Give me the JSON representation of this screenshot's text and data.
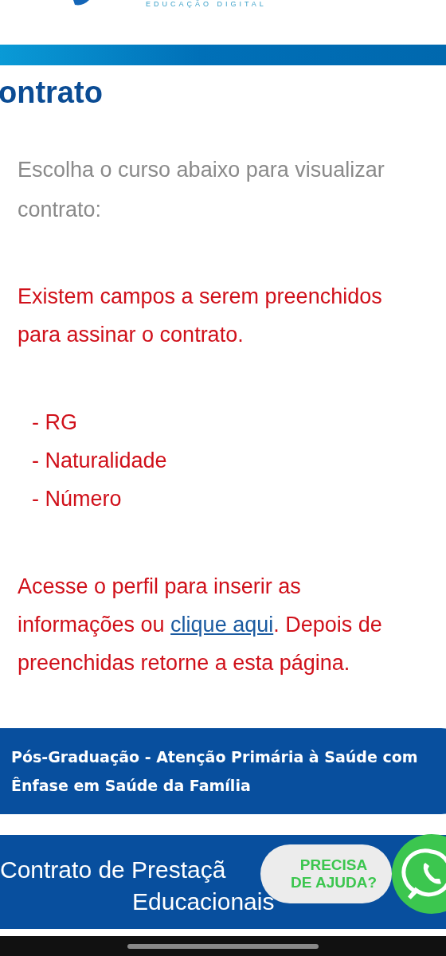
{
  "header": {
    "logo_tagline": "EDUCAÇÃO DIGITAL"
  },
  "page_title": "ontrato",
  "intro": {
    "lines": [
      "Escolha o curso abaixo para visualizar",
      "contrato:"
    ]
  },
  "warning": "Existem campos a serem preenchidos para assinar o contrato.",
  "missing_fields": [
    "- RG",
    "- Naturalidade",
    "- Número"
  ],
  "instructions": {
    "before": "Acesse o perfil para inserir as informações ou ",
    "link": "clique aqui",
    "after": ". Depois de preenchidas retorne a esta página."
  },
  "course_button": "Pós-Graduação - Atenção Primária à Saúde com Ênfase em Saúde da Família",
  "contract_banner": {
    "lines": [
      "Contrato de Prestaçã",
      "Educacionais"
    ]
  },
  "help_widget": {
    "lines": [
      "PRECISA",
      "DE AJUDA?"
    ]
  }
}
